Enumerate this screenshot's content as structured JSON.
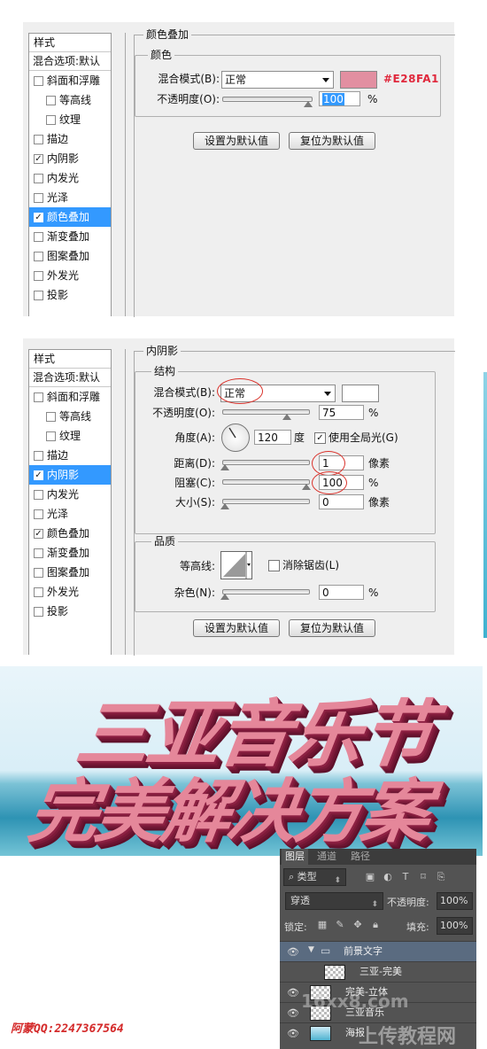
{
  "styles_list": {
    "header": "样式",
    "blend_options": "混合选项:默认",
    "items": [
      {
        "label": "斜面和浮雕",
        "sub": false
      },
      {
        "label": "等高线",
        "sub": true
      },
      {
        "label": "纹理",
        "sub": true
      },
      {
        "label": "描边",
        "sub": false
      },
      {
        "label": "内阴影",
        "sub": false
      },
      {
        "label": "内发光",
        "sub": false
      },
      {
        "label": "光泽",
        "sub": false
      },
      {
        "label": "颜色叠加",
        "sub": false
      },
      {
        "label": "渐变叠加",
        "sub": false
      },
      {
        "label": "图案叠加",
        "sub": false
      },
      {
        "label": "外发光",
        "sub": false
      },
      {
        "label": "投影",
        "sub": false
      }
    ],
    "check_mark": "✓"
  },
  "dialog1": {
    "section_title": "颜色叠加",
    "group_title": "颜色",
    "blend_mode_label": "混合模式(B):",
    "blend_mode_value": "正常",
    "color_hex_label": "#E28FA1",
    "swatch_color": "#E28FA1",
    "opacity_label": "不透明度(O):",
    "opacity_value": "100",
    "opacity_unit": "%",
    "btn_default": "设置为默认值",
    "btn_reset": "复位为默认值"
  },
  "dialog2": {
    "section_title": "内阴影",
    "group_structure": "结构",
    "blend_mode_label": "混合模式(B):",
    "blend_mode_value": "正常",
    "swatch_color": "#FFFFFF",
    "opacity_label": "不透明度(O):",
    "opacity_value": "75",
    "opacity_unit": "%",
    "angle_label": "角度(A):",
    "angle_value": "120",
    "angle_unit": "度",
    "global_light_label": "使用全局光(G)",
    "distance_label": "距离(D):",
    "distance_value": "1",
    "distance_unit": "像素",
    "choke_label": "阻塞(C):",
    "choke_value": "100",
    "choke_unit": "%",
    "size_label": "大小(S):",
    "size_value": "0",
    "size_unit": "像素",
    "group_quality": "品质",
    "contour_label": "等高线:",
    "antialias_label": "消除锯齿(L)",
    "noise_label": "杂色(N):",
    "noise_value": "0",
    "noise_unit": "%",
    "btn_default": "设置为默认值",
    "btn_reset": "复位为默认值"
  },
  "banner": {
    "line1": "三亚音乐节",
    "line2": "完美解决方案"
  },
  "layers_panel": {
    "tabs": [
      "图层",
      "通道",
      "路径"
    ],
    "filter_kind": "类型",
    "blend_mode": "穿透",
    "opacity_label": "不透明度:",
    "opacity_value": "100%",
    "lock_label": "锁定:",
    "fill_label": "填充:",
    "fill_value": "100%",
    "layers": [
      {
        "name": "前景文字",
        "type": "group"
      },
      {
        "name": "三亚-完美",
        "type": "layer"
      },
      {
        "name": "完美-立体",
        "type": "layer"
      },
      {
        "name": "三亚音乐",
        "type": "layer"
      },
      {
        "name": "海报",
        "type": "layer"
      }
    ]
  },
  "credit": "阿蒙QQ:2247367564",
  "watermark": "16xx8.com",
  "watermark2": "上传教程网"
}
